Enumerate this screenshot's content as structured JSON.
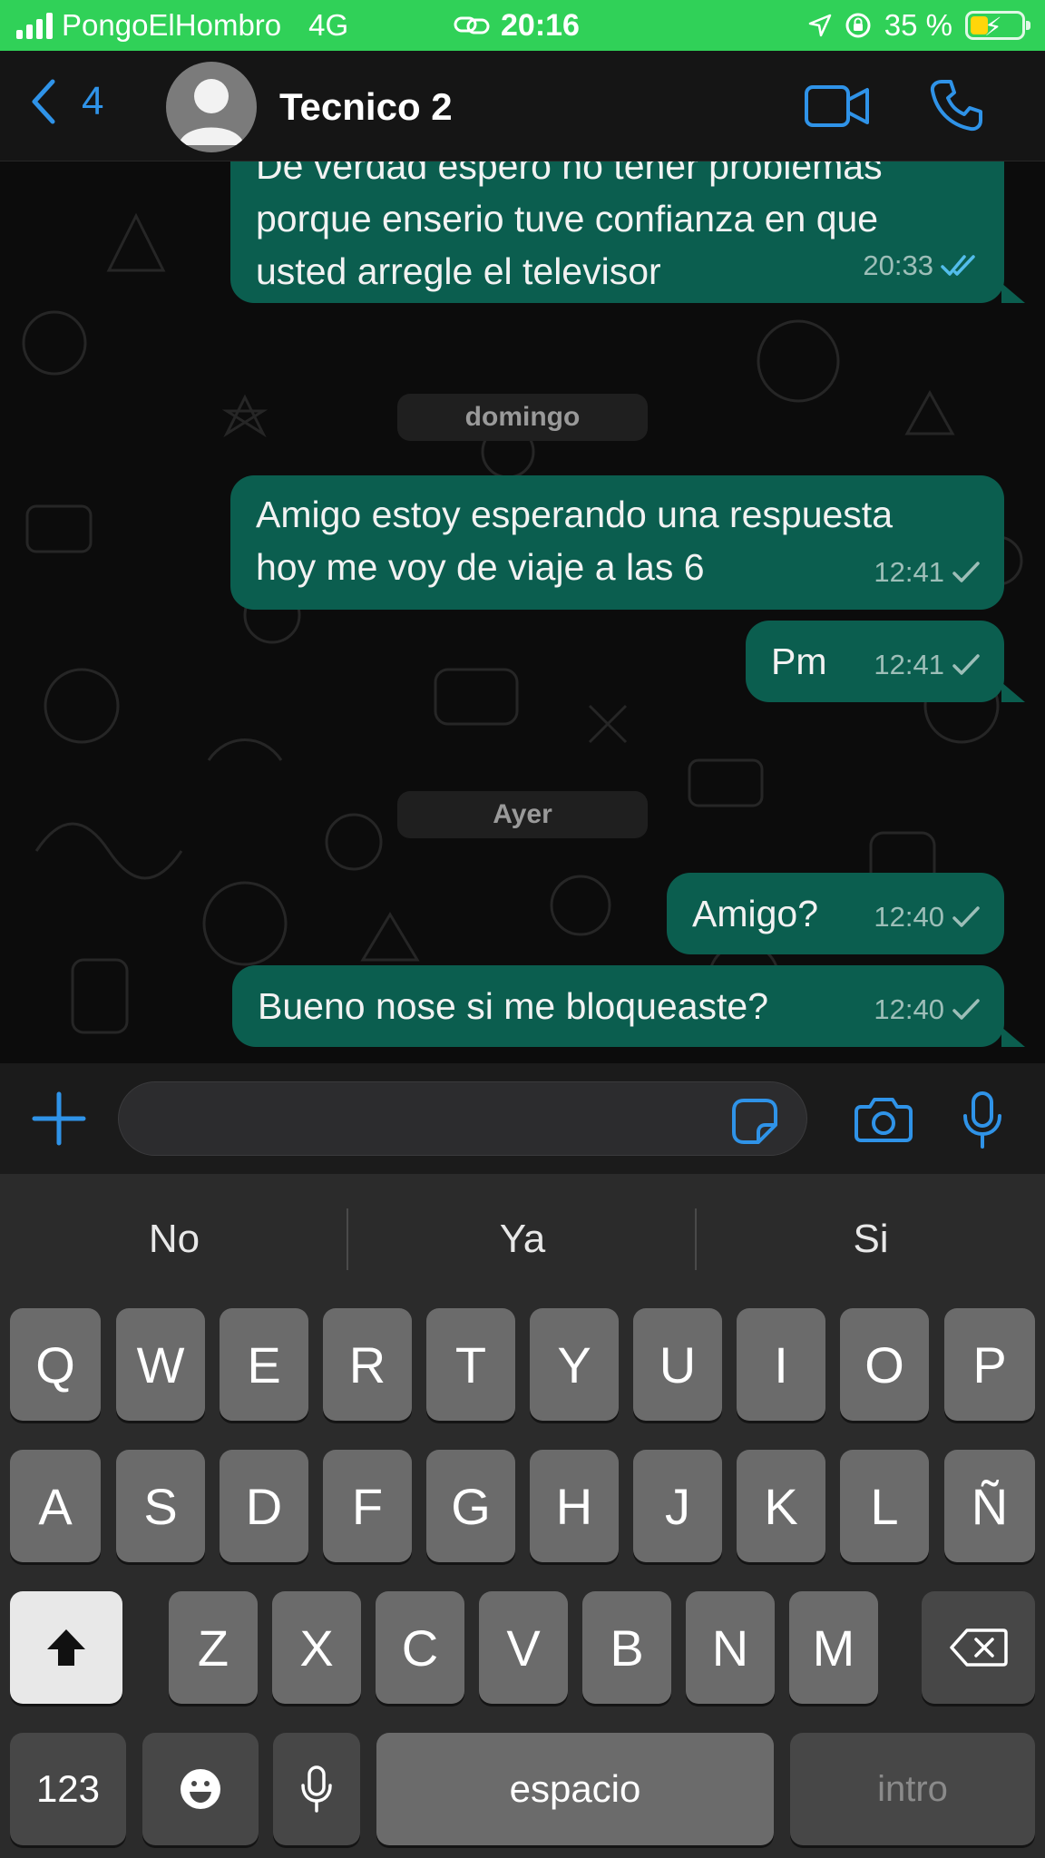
{
  "status_bar": {
    "carrier": "PongoElHombro",
    "network": "4G",
    "time": "20:16",
    "battery_percent": "35 %",
    "battery_level": 0.35
  },
  "header": {
    "back_count": "4",
    "contact_name": "Tecnico 2"
  },
  "messages": [
    {
      "lines": [
        "De verdad espero no tener problemas",
        "porque enserio tuve confianza en que",
        "usted arregle el televisor"
      ],
      "time": "20:33",
      "status": "read"
    },
    {
      "lines": [
        "Amigo estoy esperando una respuesta",
        "hoy me voy de viaje a las 6"
      ],
      "time": "12:41",
      "status": "sent"
    },
    {
      "lines": [
        "Pm"
      ],
      "time": "12:41",
      "status": "sent"
    },
    {
      "lines": [
        "Amigo?"
      ],
      "time": "12:40",
      "status": "sent"
    },
    {
      "lines": [
        "Bueno nose si me bloqueaste?"
      ],
      "time": "12:40",
      "status": "sent"
    }
  ],
  "date_separators": [
    "domingo",
    "Ayer"
  ],
  "input": {
    "value": "",
    "placeholder": ""
  },
  "keyboard": {
    "suggestions": [
      "No",
      "Ya",
      "Si"
    ],
    "row1": [
      "Q",
      "W",
      "E",
      "R",
      "T",
      "Y",
      "U",
      "I",
      "O",
      "P"
    ],
    "row2": [
      "A",
      "S",
      "D",
      "F",
      "G",
      "H",
      "J",
      "K",
      "L",
      "Ñ"
    ],
    "row3": [
      "Z",
      "X",
      "C",
      "V",
      "B",
      "N",
      "M"
    ],
    "numbers_key": "123",
    "space_key": "espacio",
    "return_key": "intro"
  },
  "colors": {
    "status_bar": "#30d158",
    "accent": "#2f93e8",
    "bubble": "#0b5e4f",
    "read_tick": "#53bdeb"
  },
  "icons": [
    "signal-icon",
    "link-icon",
    "location-arrow-icon",
    "rotation-lock-icon",
    "battery-icon",
    "chevron-left-icon",
    "video-camera-icon",
    "phone-icon",
    "plus-icon",
    "sticker-icon",
    "camera-icon",
    "microphone-icon",
    "shift-icon",
    "backspace-icon",
    "emoji-icon"
  ]
}
